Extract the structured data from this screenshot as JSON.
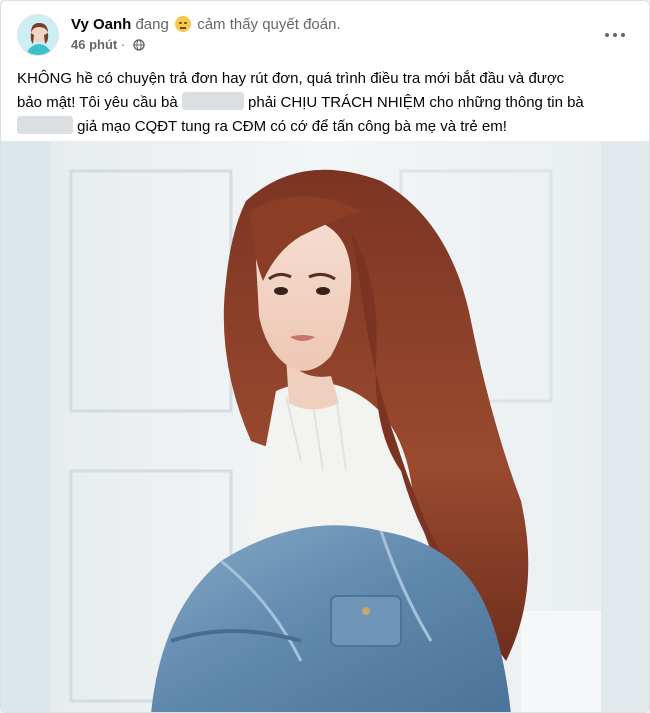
{
  "post": {
    "author": "Vy Oanh",
    "feeling_prefix": "đang",
    "feeling_icon": "smiling-face-emoji",
    "feeling_text": "cảm thấy quyết đoán.",
    "timestamp": "46 phút",
    "privacy_icon": "globe-icon",
    "menu_icon": "more-options-icon",
    "lines": {
      "l1": "KHÔNG hề có chuyện trả đơn hay rút đơn, quá trình điều tra mới bắt đầu và được",
      "l2a": "bảo mật! Tôi yêu cầu bà",
      "l2b": "phải CHỊU TRÁCH NHIỆM cho những thông tin bà",
      "l3": "giả mạo CQĐT tung ra CĐM có cớ để tấn công bà mẹ và trẻ em!"
    }
  },
  "colors": {
    "background": "#ffffff",
    "secondary_text": "#65676b",
    "hair": "#8a3b23",
    "sweater": "#f4f4f2",
    "jacket": "#6c93b5",
    "wall": "#edf1f3"
  }
}
